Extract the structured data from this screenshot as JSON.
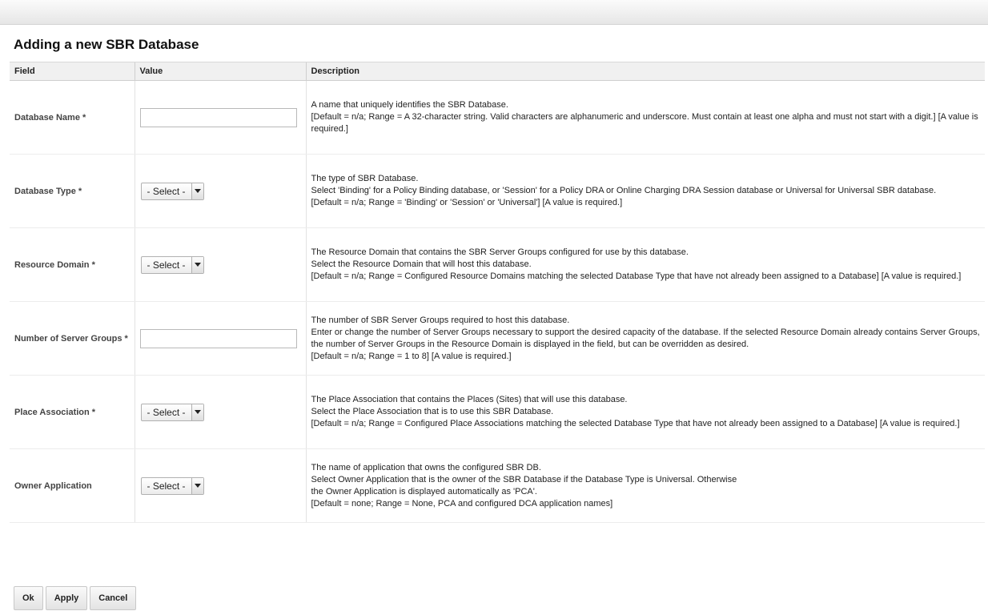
{
  "page": {
    "title": "Adding a new SBR Database"
  },
  "table": {
    "headers": {
      "field": "Field",
      "value": "Value",
      "description": "Description"
    },
    "rows": [
      {
        "field": "Database Name *",
        "control": "text",
        "value": "",
        "description": [
          "A name that uniquely identifies the SBR Database.",
          "[Default = n/a; Range = A 32-character string. Valid characters are alphanumeric and underscore. Must contain at least one alpha and must not start with a digit.] [A value is required.]"
        ]
      },
      {
        "field": "Database Type *",
        "control": "select",
        "value": "- Select -",
        "description": [
          "The type of SBR Database.",
          "Select 'Binding' for a Policy Binding database, or 'Session' for a Policy DRA or Online Charging DRA Session database or Universal for Universal SBR database.",
          "[Default = n/a; Range = 'Binding' or 'Session' or 'Universal'] [A value is required.]"
        ]
      },
      {
        "field": "Resource Domain *",
        "control": "select",
        "value": "- Select -",
        "description": [
          "The Resource Domain that contains the SBR Server Groups configured for use by this database.",
          "Select the Resource Domain that will host this database.",
          "[Default = n/a; Range = Configured Resource Domains matching the selected Database Type that have not already been assigned to a Database] [A value is required.]"
        ]
      },
      {
        "field": "Number of Server Groups *",
        "control": "text",
        "value": "",
        "description": [
          "The number of SBR Server Groups required to host this database.",
          "Enter or change the number of Server Groups necessary to support the desired capacity of the database. If the selected Resource Domain already contains Server Groups, the number of Server Groups in the Resource Domain is displayed in the field, but can be overridden as desired.",
          "[Default = n/a; Range = 1 to 8] [A value is required.]"
        ]
      },
      {
        "field": "Place Association *",
        "control": "select",
        "value": "- Select -",
        "description": [
          "The Place Association that contains the Places (Sites) that will use this database.",
          "Select the Place Association that is to use this SBR Database.",
          "[Default = n/a; Range = Configured Place Associations matching the selected Database Type that have not already been assigned to a Database] [A value is required.]"
        ]
      },
      {
        "field": "Owner Application",
        "control": "select",
        "value": "- Select -",
        "description": [
          "The name of application that owns the configured SBR DB.",
          "Select Owner Application that is the owner of the SBR Database if the Database Type is Universal. Otherwise",
          "the Owner Application is displayed automatically as 'PCA'.",
          "[Default = none; Range = None, PCA and configured DCA application names]"
        ]
      }
    ]
  },
  "buttons": {
    "ok": "Ok",
    "apply": "Apply",
    "cancel": "Cancel"
  }
}
